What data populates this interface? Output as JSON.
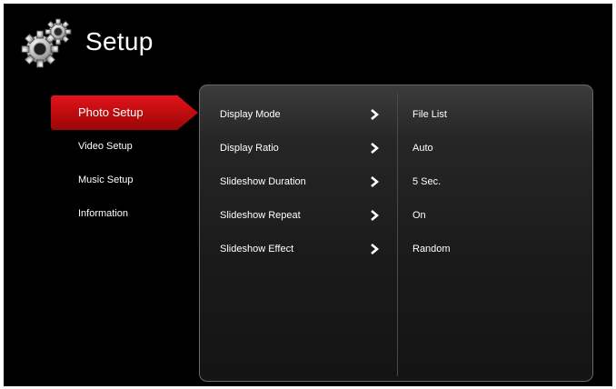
{
  "header": {
    "title": "Setup",
    "icon": "gears-icon"
  },
  "sidebar": {
    "items": [
      {
        "label": "Photo Setup",
        "active": true
      },
      {
        "label": "Video Setup",
        "active": false
      },
      {
        "label": "Music Setup",
        "active": false
      },
      {
        "label": "Information",
        "active": false
      }
    ]
  },
  "settings": {
    "rows": [
      {
        "label": "Display Mode",
        "value": "File List"
      },
      {
        "label": "Display Ratio",
        "value": "Auto"
      },
      {
        "label": "Slideshow Duration",
        "value": "5 Sec."
      },
      {
        "label": "Slideshow Repeat",
        "value": "On"
      },
      {
        "label": "Slideshow Effect",
        "value": "Random"
      }
    ],
    "arrow_icon": "chevron-right-icon"
  },
  "colors": {
    "accent": "#c20d10",
    "background": "#000000",
    "panel_border": "#6a6a6a",
    "text": "#ffffff"
  }
}
